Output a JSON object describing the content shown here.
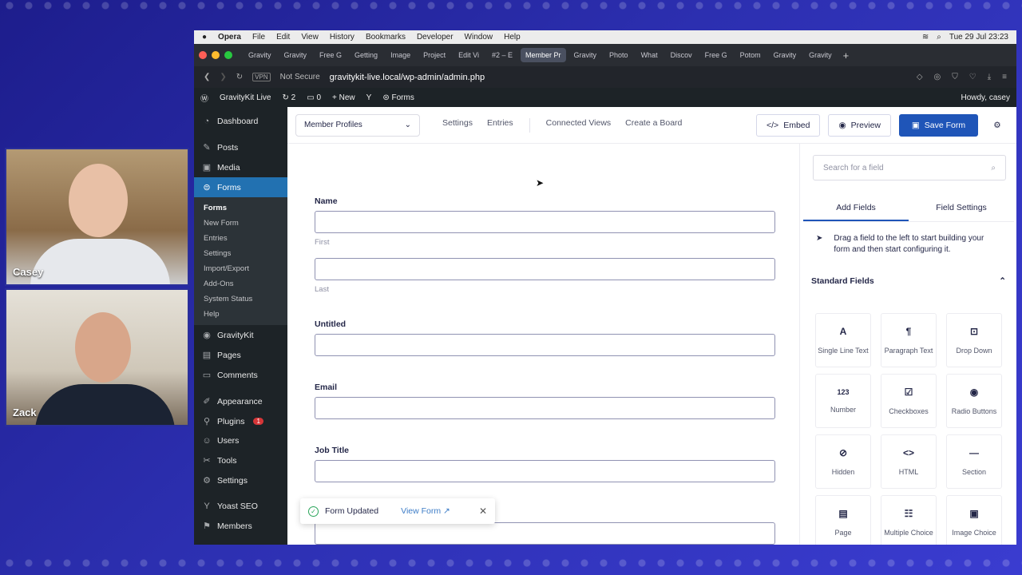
{
  "people": {
    "top": "Casey",
    "bottom": "Zack"
  },
  "macbar": {
    "app": "Opera",
    "menus": [
      "File",
      "Edit",
      "View",
      "History",
      "Bookmarks",
      "Developer",
      "Window",
      "Help"
    ],
    "datetime": "Tue 29 Jul  23:23"
  },
  "tabs": [
    "Gravity",
    "Gravity",
    "Free G",
    "Getting",
    "Image",
    "Project",
    "Edit Vi",
    "#2 – E",
    "Member Pr",
    "Gravity",
    "Photo",
    "What",
    "Discov",
    "Free G",
    "Potom",
    "Gravity",
    "Gravity"
  ],
  "url": {
    "security": "Not Secure",
    "address": "gravitykit-live.local/wp-admin/admin.php",
    "vpn": "VPN"
  },
  "adminbar": {
    "site": "GravityKit Live",
    "updates": "2",
    "comments": "0",
    "new": "New",
    "forms": "Forms",
    "howdy": "Howdy, casey"
  },
  "sidebar": {
    "items_top": [
      {
        "label": "Dashboard",
        "icon": "dashboard-icon"
      },
      {
        "label": "Posts",
        "icon": "pin-icon"
      },
      {
        "label": "Media",
        "icon": "media-icon"
      },
      {
        "label": "Forms",
        "icon": "forms-icon"
      }
    ],
    "submenu": [
      "Forms",
      "New Form",
      "Entries",
      "Settings",
      "Import/Export",
      "Add-Ons",
      "System Status",
      "Help"
    ],
    "items_bottom": [
      {
        "label": "GravityKit",
        "icon": "gravitykit-icon"
      },
      {
        "label": "Pages",
        "icon": "pages-icon"
      },
      {
        "label": "Comments",
        "icon": "comments-icon"
      },
      {
        "label": "Appearance",
        "icon": "appearance-icon"
      },
      {
        "label": "Plugins",
        "icon": "plugins-icon"
      },
      {
        "label": "Users",
        "icon": "users-icon"
      },
      {
        "label": "Tools",
        "icon": "tools-icon"
      },
      {
        "label": "Settings",
        "icon": "settings-icon"
      },
      {
        "label": "Yoast SEO",
        "icon": "yoast-icon"
      },
      {
        "label": "Members",
        "icon": "members-icon"
      }
    ],
    "plugins_badge": "1"
  },
  "toolbar": {
    "form_name": "Member Profiles",
    "links": [
      "Settings",
      "Entries",
      "Connected Views",
      "Create a Board"
    ],
    "embed": "Embed",
    "preview": "Preview",
    "save": "Save Form"
  },
  "form": {
    "name_label": "Name",
    "first": "First",
    "last": "Last",
    "untitled": "Untitled",
    "email": "Email",
    "job": "Job Title"
  },
  "toast": {
    "message": "Form Updated",
    "link": "View Form"
  },
  "panel": {
    "search_placeholder": "Search for a field",
    "tab_add": "Add Fields",
    "tab_settings": "Field Settings",
    "hint": "Drag a field to the left to start building your form and then start configuring it.",
    "section": "Standard Fields",
    "fields": [
      {
        "label": "Single Line Text",
        "glyph": "A"
      },
      {
        "label": "Paragraph Text",
        "glyph": "¶"
      },
      {
        "label": "Drop Down",
        "glyph": "⊡"
      },
      {
        "label": "Number",
        "glyph": "123"
      },
      {
        "label": "Checkboxes",
        "glyph": "☑"
      },
      {
        "label": "Radio Buttons",
        "glyph": "◉"
      },
      {
        "label": "Hidden",
        "glyph": "⊘"
      },
      {
        "label": "HTML",
        "glyph": "<>"
      },
      {
        "label": "Section",
        "glyph": "—"
      },
      {
        "label": "Page",
        "glyph": "▤"
      },
      {
        "label": "Multiple Choice",
        "glyph": "☷"
      },
      {
        "label": "Image Choice",
        "glyph": "▣"
      }
    ]
  }
}
